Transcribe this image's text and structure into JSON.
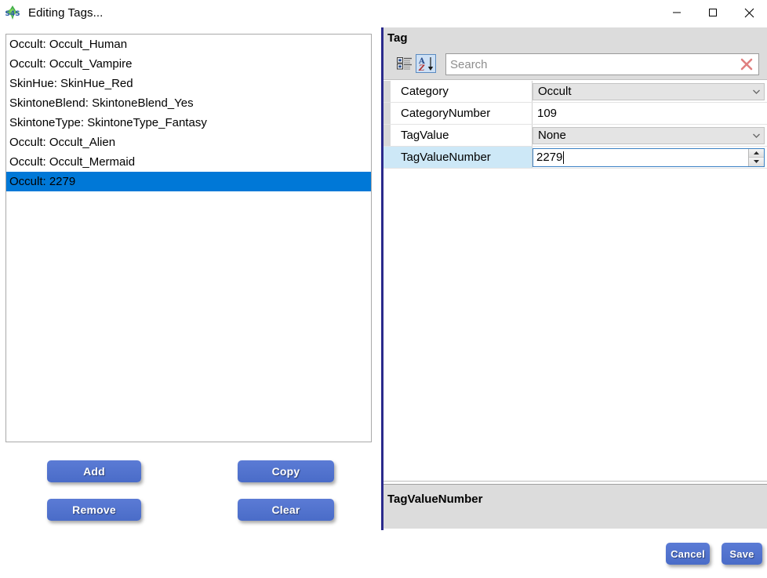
{
  "window": {
    "title": "Editing Tags...",
    "icon": "s4s-plumbob-icon",
    "controls": {
      "minimize": "minimize-icon",
      "maximize": "maximize-icon",
      "close": "close-icon"
    }
  },
  "list": {
    "items": [
      {
        "label": "Occult: Occult_Human",
        "selected": false
      },
      {
        "label": "Occult: Occult_Vampire",
        "selected": false
      },
      {
        "label": "SkinHue: SkinHue_Red",
        "selected": false
      },
      {
        "label": "SkintoneBlend: SkintoneBlend_Yes",
        "selected": false
      },
      {
        "label": "SkintoneType: SkintoneType_Fantasy",
        "selected": false
      },
      {
        "label": "Occult: Occult_Alien",
        "selected": false
      },
      {
        "label": "Occult: Occult_Mermaid",
        "selected": false
      },
      {
        "label": "Occult: 2279",
        "selected": true
      }
    ]
  },
  "buttons": {
    "add": "Add",
    "remove": "Remove",
    "copy": "Copy",
    "clear": "Clear",
    "cancel": "Cancel",
    "save": "Save"
  },
  "property_grid": {
    "title": "Tag",
    "toolbar": {
      "categorized": "categorized-view-icon",
      "alphabetical": "alphabetical-sort-icon",
      "alphabetical_active": true
    },
    "search": {
      "value": "",
      "placeholder": "Search",
      "clear_icon": "clear-x-icon"
    },
    "rows": [
      {
        "name": "Category",
        "value": "Occult",
        "editor": "combo",
        "selected": false
      },
      {
        "name": "CategoryNumber",
        "value": "109",
        "editor": "text",
        "selected": false
      },
      {
        "name": "TagValue",
        "value": "None",
        "editor": "combo",
        "selected": false
      },
      {
        "name": "TagValueNumber",
        "value": "2279",
        "editor": "spin",
        "selected": true
      }
    ],
    "description": {
      "title": "TagValueNumber",
      "body": ""
    }
  },
  "colors": {
    "selection_blue": "#0078d7",
    "button_blue": "#4a6cc8",
    "divider_navy": "#2a2a8c",
    "panel_gray": "#dcdcdc",
    "row_selected_blue": "#cde8f7"
  }
}
